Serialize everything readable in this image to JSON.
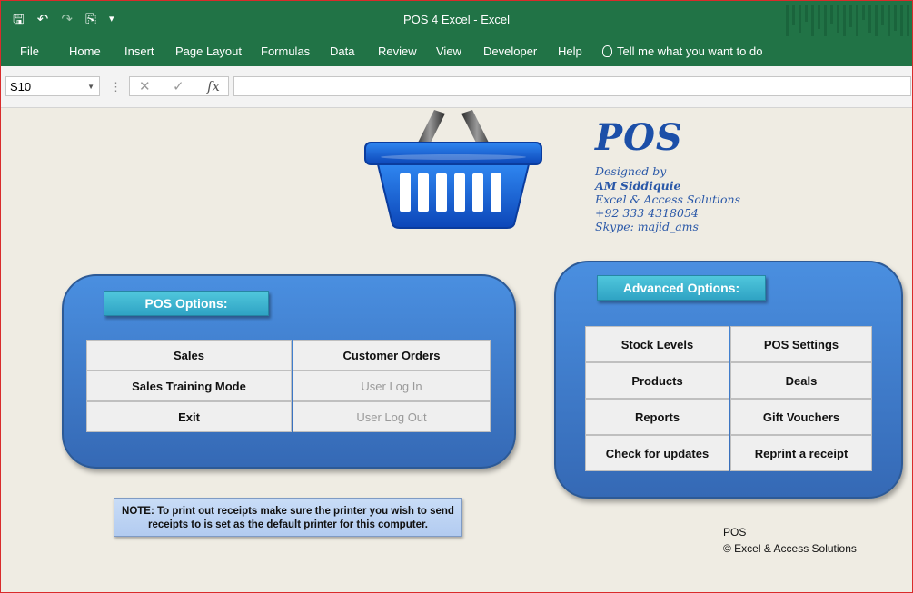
{
  "window": {
    "title": "POS 4 Excel  -  Excel",
    "quick_access": [
      {
        "icon": "save-icon",
        "glyph": "🖫"
      },
      {
        "icon": "undo-icon",
        "glyph": "↶"
      },
      {
        "icon": "redo-icon",
        "glyph": "↷"
      },
      {
        "icon": "print-preview-icon",
        "glyph": "⎘"
      },
      {
        "icon": "customize-toolbar-icon",
        "glyph": "▾"
      }
    ]
  },
  "ribbon": {
    "tabs": [
      "File",
      "Home",
      "Insert",
      "Page Layout",
      "Formulas",
      "Data",
      "Review",
      "View",
      "Developer",
      "Help"
    ],
    "tell_me": "Tell me what you want to do"
  },
  "formula_bar": {
    "name_box": "S10",
    "cancel_glyph": "✕",
    "enter_glyph": "✓",
    "fx_glyph": "fx",
    "value": ""
  },
  "branding": {
    "logo": "POS",
    "designed_by": "Designed by",
    "author": "AM Siddiquie",
    "company": "Excel & Access Solutions",
    "phone": "+92 333 4318054",
    "skype": "Skype: majid_ams"
  },
  "pos_options": {
    "header": "POS Options:",
    "buttons": {
      "sales": "Sales",
      "customer_orders": "Customer Orders",
      "training": "Sales Training Mode",
      "user_login": "User Log In",
      "exit": "Exit",
      "user_logout": "User Log Out"
    }
  },
  "advanced_options": {
    "header": "Advanced Options:",
    "buttons": {
      "stock_levels": "Stock Levels",
      "pos_settings": "POS Settings",
      "products": "Products",
      "deals": "Deals",
      "reports": "Reports",
      "gift_vouchers": "Gift Vouchers",
      "check_updates": "Check for updates",
      "reprint": "Reprint a receipt"
    }
  },
  "note": {
    "line1": "NOTE: To print out receipts make sure the printer you wish to send",
    "line2": "receipts to is set as the default printer for this computer."
  },
  "footer": {
    "line1": "POS",
    "line2": "© Excel & Access Solutions"
  },
  "colors": {
    "excel_green": "#217346",
    "panel_blue": "#3e7ccc",
    "header_teal": "#3bb4d0",
    "basket_blue": "#1565d8"
  }
}
